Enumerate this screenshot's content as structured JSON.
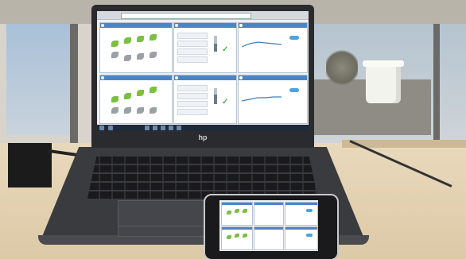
{
  "photo": {
    "laptop_brand": "hp",
    "address_bar": "",
    "colors": {
      "accent": "#4a86c6",
      "leaf": "#7bc043",
      "check": "#49b149"
    }
  },
  "dashboard": {
    "panels_top": [
      {
        "id": "plants-top",
        "icon": "leaf-icon"
      },
      {
        "id": "conditions-top",
        "icon": "gauge-icon"
      },
      {
        "id": "forecast-top",
        "icon": "info-icon"
      }
    ],
    "panels_bottom": [
      {
        "id": "plants-bottom",
        "icon": "leaf-icon"
      },
      {
        "id": "conditions-bottom",
        "icon": "gauge-icon"
      },
      {
        "id": "forecast-bottom",
        "icon": "info-icon"
      }
    ]
  }
}
